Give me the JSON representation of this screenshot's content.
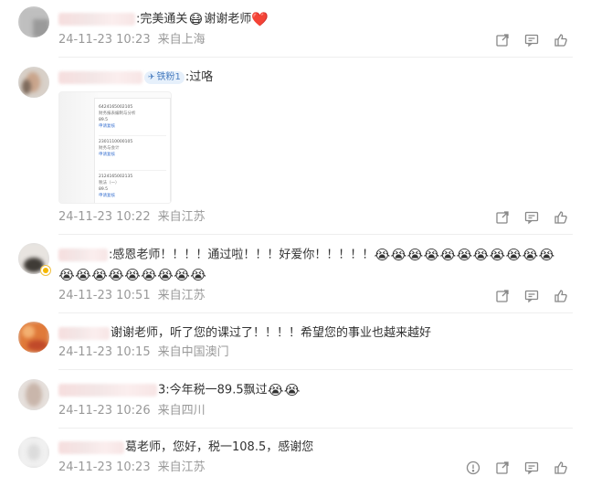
{
  "comments": [
    {
      "text": ":完美通关",
      "text2": "谢谢老师",
      "emojis": [
        "😷",
        "❤️"
      ],
      "date": "24-11-23 10:23",
      "location": "来自上海"
    },
    {
      "badge": "铁粉1",
      "text": ":过咯",
      "date": "24-11-23 10:22",
      "location": "来自江苏",
      "image_rows": [
        {
          "code": "6424165002105",
          "name": "财务报表编制与分析",
          "score": "89.5",
          "link": "申请复核"
        },
        {
          "code": "2301110000105",
          "name": "财务与会计",
          "score": "",
          "link": "申请复核"
        },
        {
          "code": "2124165002135",
          "name": "税法（一）",
          "score": "89.5",
          "link": "申请复核"
        }
      ]
    },
    {
      "text": ":感恩老师！！！！通过啦！！！好爱你！！！！！",
      "emoji": "😭",
      "emoji_count_line1": 11,
      "emoji_count_line2": 9,
      "date": "24-11-23 10:51",
      "location": "来自江苏"
    },
    {
      "text": "谢谢老师，听了您的课过了！！！！希望您的事业也越来越好",
      "date": "24-11-23 10:15",
      "location": "来自中国澳门"
    },
    {
      "text": "3:今年税一89.5飘过",
      "emojis": [
        "😭",
        "😭"
      ],
      "date": "24-11-23 10:26",
      "location": "来自四川"
    },
    {
      "text": "葛老师，您好，税一108.5，感谢您",
      "date": "24-11-23 10:23",
      "location": "来自江苏"
    }
  ],
  "icons": {
    "share": "share-icon",
    "reply": "reply-icon",
    "like": "thumbs-up-icon",
    "report": "report-icon"
  }
}
